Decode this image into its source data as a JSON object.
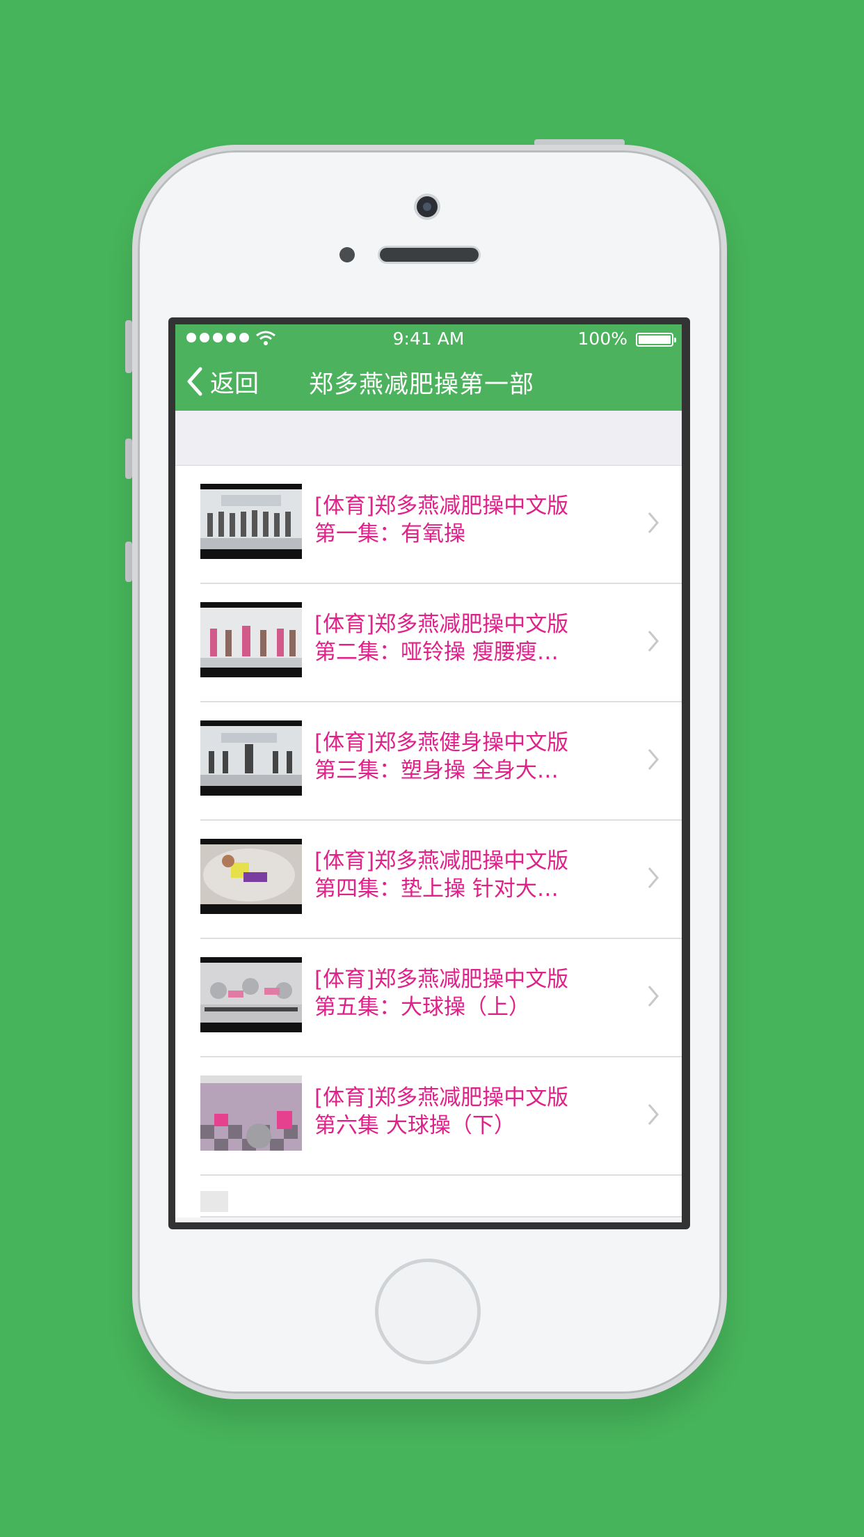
{
  "status_bar": {
    "time": "9:41 AM",
    "battery": "100%",
    "signal_icon": "signal-dots-icon",
    "wifi_icon": "wifi-icon",
    "battery_icon": "battery-icon"
  },
  "nav": {
    "back_label": "返回",
    "title": "郑多燕减肥操第一部"
  },
  "videos": [
    {
      "line1": "[体育]郑多燕减肥操中文版",
      "line2": "第一集：有氧操"
    },
    {
      "line1": "[体育]郑多燕减肥操中文版",
      "line2": "第二集：哑铃操 瘦腰瘦…"
    },
    {
      "line1": "[体育]郑多燕健身操中文版",
      "line2": "第三集：塑身操 全身大…"
    },
    {
      "line1": "[体育]郑多燕减肥操中文版",
      "line2": "第四集：垫上操 针对大…"
    },
    {
      "line1": "[体育]郑多燕减肥操中文版",
      "line2": "第五集：大球操（上）"
    },
    {
      "line1": "[体育]郑多燕减肥操中文版",
      "line2": "第六集 大球操（下）"
    }
  ],
  "colors": {
    "background": "#46b45a",
    "nav": "#4cb25d",
    "title_text": "#e0218a"
  }
}
